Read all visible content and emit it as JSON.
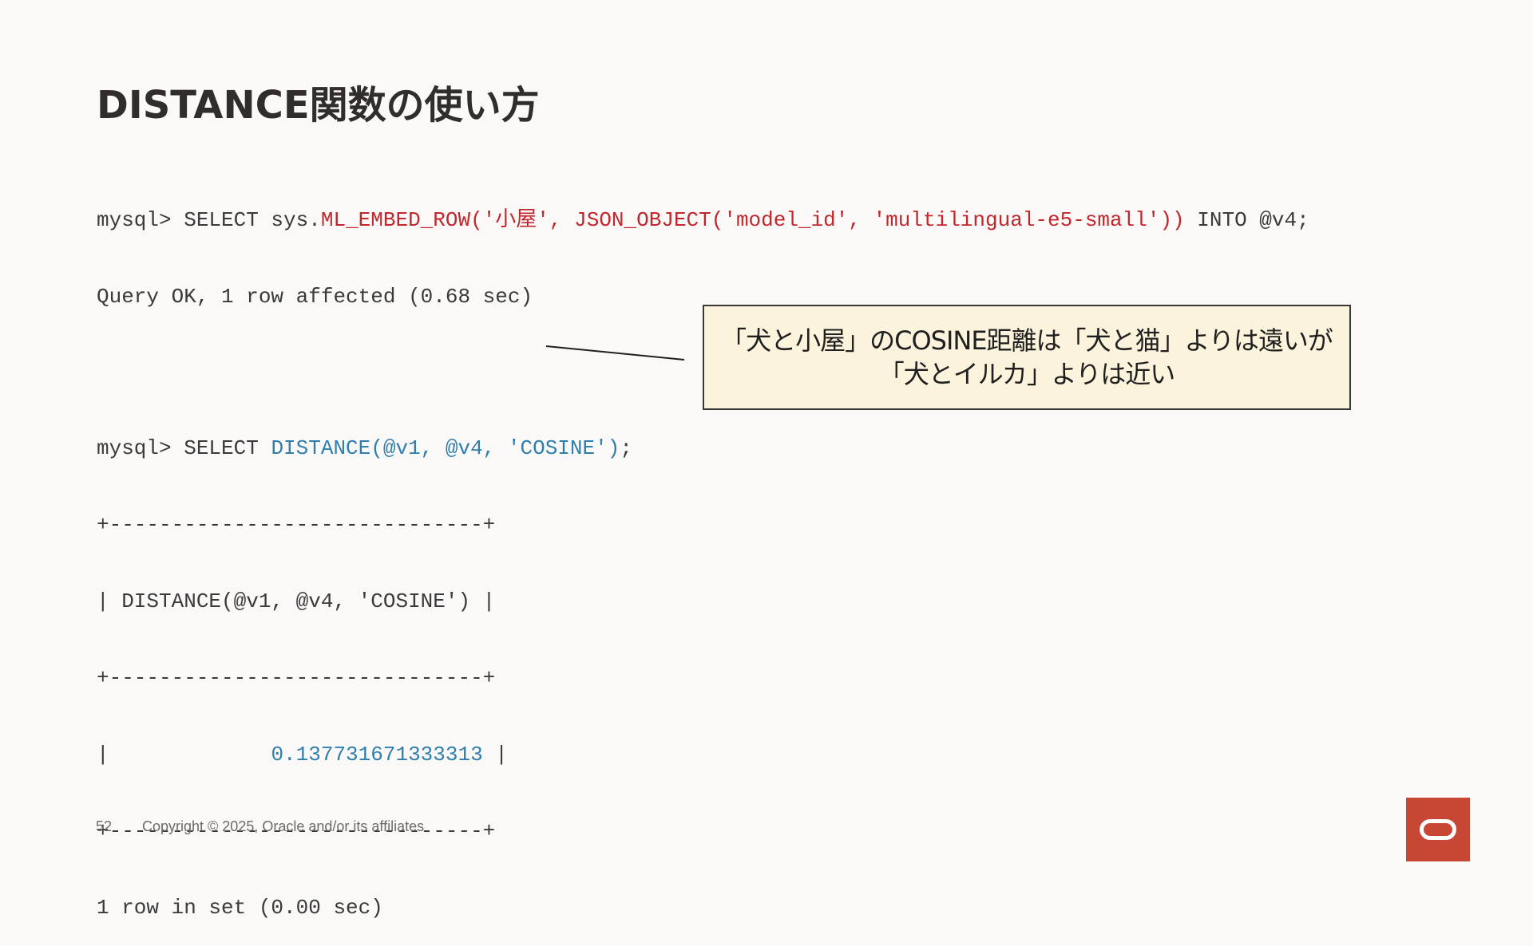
{
  "slide": {
    "title": "DISTANCE関数の使い方"
  },
  "code": {
    "l1_prompt": "mysql> SELECT sys.",
    "l1_func": "ML_EMBED_ROW(",
    "l1_str": "'小屋',",
    "l1_json": " JSON_OBJECT('model_id', 'multilingual-e5-small'))",
    "l1_end": " INTO @v4;",
    "l2": "Query OK, 1 row affected (0.68 sec)",
    "l3_prompt": "mysql> SELECT ",
    "l3_func": "DISTANCE(@v1, @v4, 'COSINE')",
    "l3_end": ";",
    "border": "+------------------------------+",
    "header_row": "| DISTANCE(@v1, @v4, 'COSINE') |",
    "row_start": "|             ",
    "value": "0.137731671333313",
    "row_end": " |",
    "footer": "1 row in set (0.00 sec)"
  },
  "callout": {
    "line1": "「犬と小屋」のCOSINE距離は「犬と猫」よりは遠いが",
    "line2": "「犬とイルカ」よりは近い"
  },
  "footer": {
    "page_number": "52",
    "copyright": "Copyright © 2025, Oracle and/or its affiliates"
  },
  "colors": {
    "background": "#fbf9f8",
    "code_string": "#c0272d",
    "code_function": "#2f7fae",
    "callout_fill": "#fcf3dc",
    "oracle_red": "#c74634"
  },
  "icons": {
    "logo": "oracle-logo-icon"
  }
}
